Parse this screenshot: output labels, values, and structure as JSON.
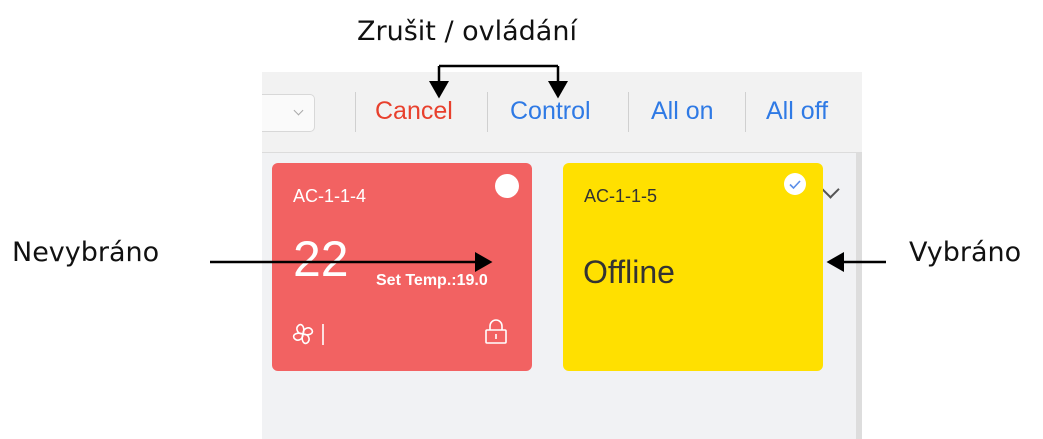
{
  "annotations": {
    "top": "Zrušit / ovládání",
    "left": "Nevybráno",
    "right": "Vybráno"
  },
  "toolbar": {
    "cancel_label": "Cancel",
    "control_label": "Control",
    "all_on_label": "All on",
    "all_off_label": "All off"
  },
  "devices": [
    {
      "name": "AC-1-1-4",
      "temperature": "22",
      "set_temp": "Set Temp.:19.0",
      "selected": false
    },
    {
      "name": "AC-1-1-5",
      "status": "Offline",
      "selected": true
    }
  ],
  "colors": {
    "cancel": "#e8402d",
    "action": "#2f7ae5",
    "card_online": "#f26262",
    "card_offline": "#ffe000"
  },
  "icons": [
    "fan-icon",
    "lock-icon",
    "check-icon",
    "chevron-down-icon"
  ]
}
